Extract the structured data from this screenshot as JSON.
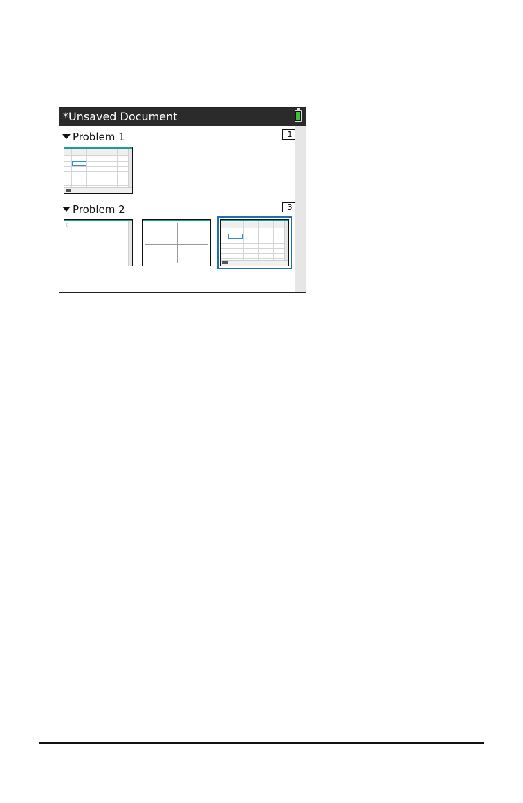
{
  "window": {
    "title": "*Unsaved Document"
  },
  "problems": [
    {
      "label": "Problem 1",
      "page_count": "1"
    },
    {
      "label": "Problem 2",
      "page_count": "3"
    }
  ],
  "icons": {
    "battery": "battery-icon",
    "expand": "triangle-down-icon",
    "pages": "page-count-icon"
  },
  "colors": {
    "titlebar": "#2b2b2b",
    "battery_fill": "#3fc23a",
    "selection": "#1f6fb3"
  }
}
